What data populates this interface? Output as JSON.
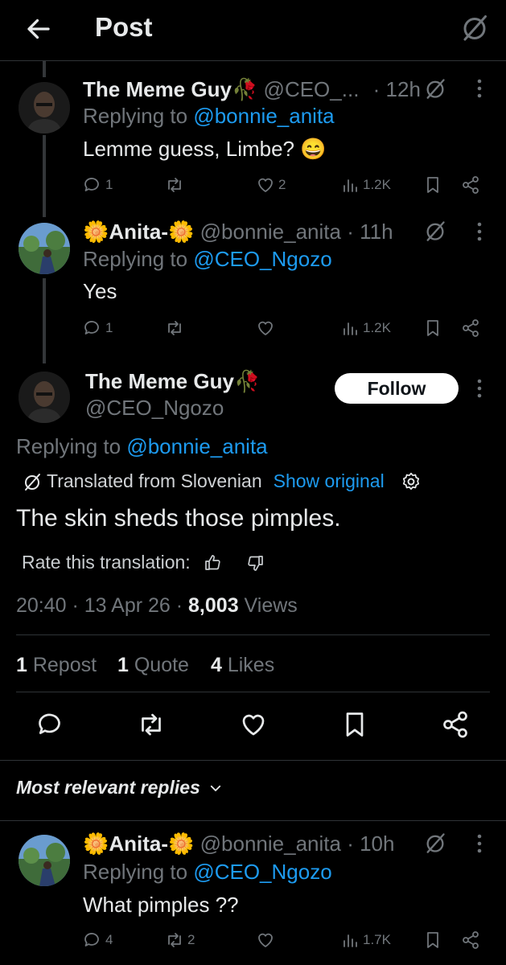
{
  "header": {
    "title": "Post"
  },
  "replies_above": [
    {
      "name": "The Meme Guy",
      "name_emoji": "🥀",
      "handle": "@CEO_...",
      "time": "· 12h",
      "replying_prefix": "Replying to ",
      "replying_to": "@bonnie_anita",
      "text": "Lemme guess, Limbe? 😄",
      "replies": "1",
      "reposts": "",
      "likes": "2",
      "views": "1.2K"
    },
    {
      "name": "Anita-",
      "name_emoji": "🌼",
      "handle": "@bonnie_anita",
      "time": "· 11h",
      "replying_prefix": "Replying to ",
      "replying_to": "@CEO_Ngozo",
      "text": "Yes",
      "replies": "1",
      "reposts": "",
      "likes": "",
      "views": "1.2K"
    }
  ],
  "main_post": {
    "name": "The Meme Guy",
    "name_emoji": "🥀",
    "handle": "@CEO_Ngozo",
    "follow_label": "Follow",
    "replying_prefix": "Replying to ",
    "replying_to": "@bonnie_anita",
    "translated_label": "Translated from Slovenian",
    "show_original": "Show original",
    "text": "The skin sheds those pimples.",
    "rate_label": "Rate this translation:",
    "time": "20:40 · 13 Apr 26 · ",
    "views_count": "8,003",
    "views_label": " Views",
    "reposts_count": "1",
    "reposts_label": " Repost",
    "quotes_count": "1",
    "quotes_label": " Quote",
    "likes_count": "4",
    "likes_label": " Likes"
  },
  "replies_section": {
    "label": "Most relevant replies"
  },
  "reply_below": {
    "name": "Anita-",
    "name_emoji": "🌼",
    "handle": "@bonnie_anita",
    "time": "· 10h",
    "replying_prefix": "Replying to ",
    "replying_to": "@CEO_Ngozo",
    "text": "What pimples ??",
    "replies": "4",
    "reposts": "2",
    "likes": "",
    "views": "1.7K"
  },
  "colors": {
    "background": "#000000",
    "text": "#e7e9ea",
    "muted": "#71767b",
    "link": "#1d9bf0",
    "divider": "#2f3336"
  },
  "icons": [
    "back-arrow-icon",
    "translate-icon",
    "more-icon",
    "reply-icon",
    "repost-icon",
    "like-icon",
    "views-icon",
    "bookmark-icon",
    "share-icon",
    "gear-icon",
    "thumbs-up-icon",
    "thumbs-down-icon",
    "chevron-down-icon"
  ]
}
